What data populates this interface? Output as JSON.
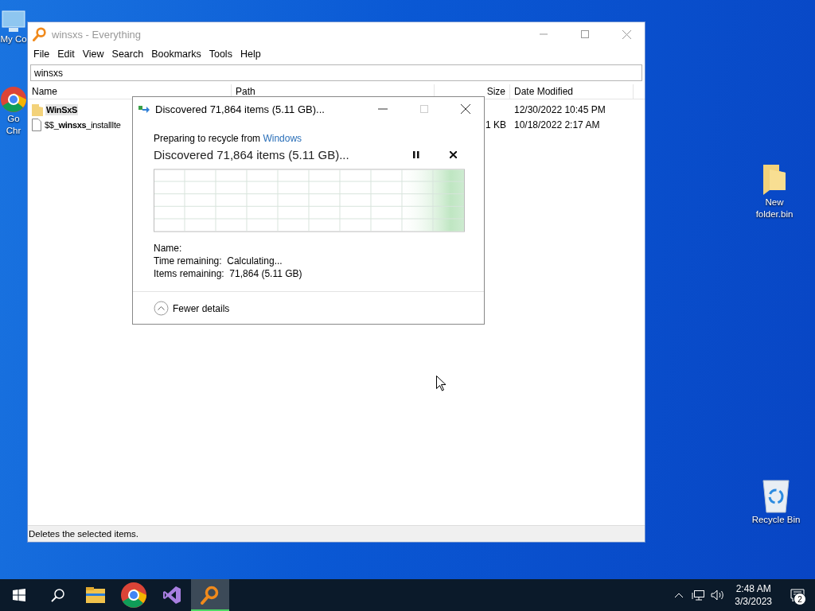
{
  "desktop_icons": [
    {
      "kind": "computer",
      "lines": [
        "My Co"
      ]
    },
    {
      "kind": "chrome",
      "lines": [
        "Go",
        "Chr"
      ]
    },
    {
      "kind": "folder",
      "lines": [
        "New",
        "folder.bin"
      ]
    },
    {
      "kind": "recycle",
      "lines": [
        "Recycle Bin"
      ]
    }
  ],
  "window": {
    "title": "winsxs - Everything",
    "menu": [
      "File",
      "Edit",
      "View",
      "Search",
      "Bookmarks",
      "Tools",
      "Help"
    ],
    "search": {
      "value": "winsxs"
    },
    "columns": [
      "Name",
      "Path",
      "Size",
      "Date Modified"
    ],
    "rows": [
      {
        "kind": "folder",
        "selected": true,
        "cells": [
          "WinSxS",
          "",
          "",
          "12/30/2022 10:45 PM"
        ]
      },
      {
        "kind": "file",
        "selected": false,
        "cells": [
          "$$_**winsxs**_installIte",
          "",
          "1 KB",
          "10/18/2022 2:17 AM"
        ]
      }
    ],
    "status_bar": "Deletes the selected items."
  },
  "dialog": {
    "title": "Discovered 71,864 items (5.11 GB)...",
    "source_prefix": "Preparing to recycle from",
    "source_link": "Windows",
    "heading": "Discovered 71,864 items (5.11 GB)...",
    "details": [
      {
        "label": "Name:"
      },
      {
        "label": "Time remaining:",
        "value": "Calculating..."
      },
      {
        "label": "Items remaining:",
        "value": "71,864 (5.11 GB)"
      }
    ],
    "toggle": "Fewer details"
  },
  "taskbar": {
    "apps": [
      {
        "kind": "explorer",
        "active": false
      },
      {
        "kind": "chrome",
        "active": false
      },
      {
        "kind": "visualstudio",
        "active": false
      },
      {
        "kind": "everything",
        "active": true
      }
    ],
    "time": "2:48 AM",
    "date": "3/3/2023",
    "notification_count": "2"
  }
}
